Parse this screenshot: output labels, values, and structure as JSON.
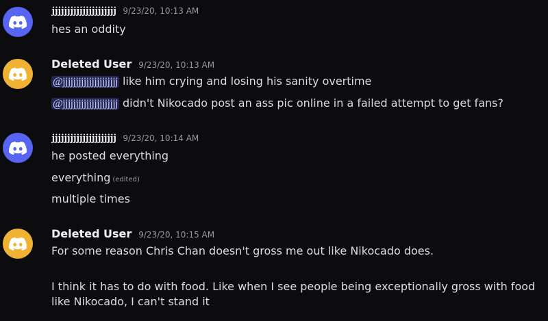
{
  "colors": {
    "background": "#0c0c0e",
    "avatar_blurple": "#5865f2",
    "avatar_orange": "#f0b232",
    "mention_bg": "#3c4270",
    "timestamp": "#949ba4",
    "text": "#dbdee1"
  },
  "messages": [
    {
      "author": "jjjjjjjjjjjjjjjjjjjjj",
      "avatar_icon": "discord-logo-icon",
      "timestamp": "9/23/20, 10:13 AM",
      "lines": [
        "hes an oddity"
      ]
    },
    {
      "author": "Deleted User",
      "avatar_icon": "discord-logo-icon",
      "timestamp": "9/23/20, 10:13 AM",
      "lines": [
        {
          "mention": "@jjjjjjjjjjjjjjjjjjjjj",
          "text": " like him crying and losing his sanity overtime"
        },
        {
          "mention": "@jjjjjjjjjjjjjjjjjjjjj",
          "text": " didn't Nikocado post an ass pic online in a failed attempt to get fans?"
        }
      ]
    },
    {
      "author": "jjjjjjjjjjjjjjjjjjjjj",
      "avatar_icon": "discord-logo-icon",
      "timestamp": "9/23/20, 10:14 AM",
      "lines": [
        "he posted everything",
        {
          "text": "everything",
          "edited": "(edited)"
        },
        "multiple times"
      ]
    },
    {
      "author": "Deleted User",
      "avatar_icon": "discord-logo-icon",
      "timestamp": "9/23/20, 10:15 AM",
      "lines": [
        "For some reason Chris Chan doesn't gross me out like Nikocado does.",
        "I think it has to do with food. Like when I see people being exceptionally gross with food like Nikocado, I can't stand it"
      ]
    }
  ]
}
